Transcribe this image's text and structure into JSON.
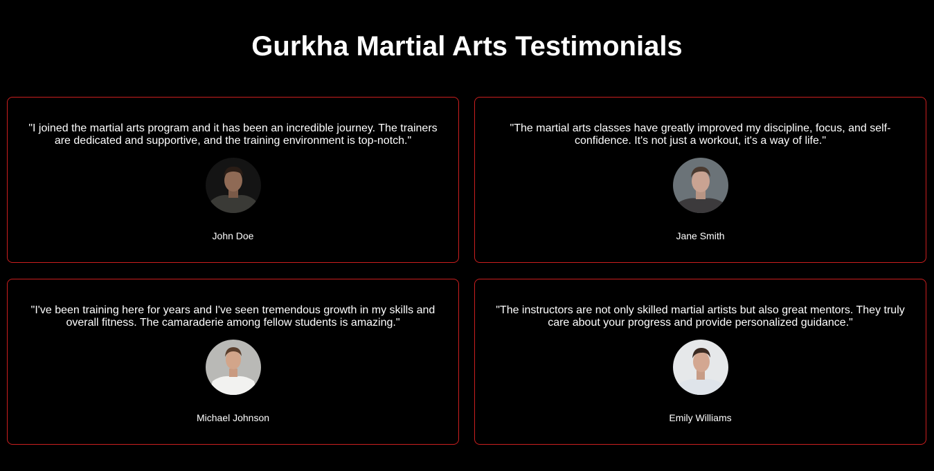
{
  "page": {
    "title": "Gurkha Martial Arts Testimonials"
  },
  "colors": {
    "background": "#000000",
    "text": "#ffffff",
    "card_border": "#cc1f1f"
  },
  "testimonials": [
    {
      "quote": "\"I joined the martial arts program and it has been an incredible journey. The trainers are dedicated and supportive, and the training environment is top-notch.\"",
      "name": "John Doe",
      "avatar": "person-photo-dark-jacket"
    },
    {
      "quote": "\"The martial arts classes have greatly improved my discipline, focus, and self-confidence. It's not just a workout, it's a way of life.\"",
      "name": "Jane Smith",
      "avatar": "person-photo-grey-background"
    },
    {
      "quote": "\"I've been training here for years and I've seen tremendous growth in my skills and overall fitness. The camaraderie among fellow students is amazing.\"",
      "name": "Michael Johnson",
      "avatar": "person-photo-white-tshirt"
    },
    {
      "quote": "\"The instructors are not only skilled martial artists but also great mentors. They truly care about your progress and provide personalized guidance.\"",
      "name": "Emily Williams",
      "avatar": "person-photo-light-shirt"
    }
  ]
}
